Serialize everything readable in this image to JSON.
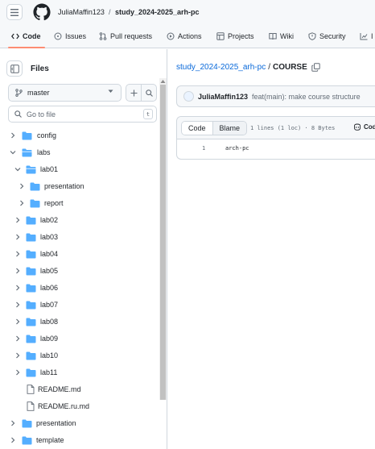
{
  "header": {
    "owner": "JuliaMaffin123",
    "separator": "/",
    "repo": "study_2024-2025_arh-pc"
  },
  "nav": {
    "tabs": [
      {
        "label": "Code",
        "icon": "code-icon"
      },
      {
        "label": "Issues",
        "icon": "issue-icon"
      },
      {
        "label": "Pull requests",
        "icon": "pull-request-icon"
      },
      {
        "label": "Actions",
        "icon": "play-icon"
      },
      {
        "label": "Projects",
        "icon": "table-icon"
      },
      {
        "label": "Wiki",
        "icon": "book-icon"
      },
      {
        "label": "Security",
        "icon": "shield-icon"
      },
      {
        "label": "I",
        "icon": "graph-icon"
      }
    ]
  },
  "sidebar": {
    "title": "Files",
    "branch": "master",
    "search_placeholder": "Go to file",
    "shortcut": "t",
    "tree": [
      {
        "label": "config",
        "type": "folder",
        "expanded": false
      },
      {
        "label": "labs",
        "type": "folder",
        "expanded": true
      },
      {
        "label": "lab01",
        "type": "folder",
        "expanded": true
      },
      {
        "label": "presentation",
        "type": "folder",
        "expanded": false
      },
      {
        "label": "report",
        "type": "folder",
        "expanded": false
      },
      {
        "label": "lab02",
        "type": "folder",
        "expanded": false
      },
      {
        "label": "lab03",
        "type": "folder",
        "expanded": false
      },
      {
        "label": "lab04",
        "type": "folder",
        "expanded": false
      },
      {
        "label": "lab05",
        "type": "folder",
        "expanded": false
      },
      {
        "label": "lab06",
        "type": "folder",
        "expanded": false
      },
      {
        "label": "lab07",
        "type": "folder",
        "expanded": false
      },
      {
        "label": "lab08",
        "type": "folder",
        "expanded": false
      },
      {
        "label": "lab09",
        "type": "folder",
        "expanded": false
      },
      {
        "label": "lab10",
        "type": "folder",
        "expanded": false
      },
      {
        "label": "lab11",
        "type": "folder",
        "expanded": false
      },
      {
        "label": "README.md",
        "type": "file"
      },
      {
        "label": "README.ru.md",
        "type": "file"
      },
      {
        "label": "presentation",
        "type": "folder",
        "expanded": false
      },
      {
        "label": "template",
        "type": "folder",
        "expanded": false
      }
    ]
  },
  "main": {
    "path_repo": "study_2024-2025_arh-pc",
    "path_sep": "/",
    "path_file": "COURSE",
    "commit": {
      "author": "JuliaMaffin123",
      "message": "feat(main): make course structure"
    },
    "file": {
      "view_code": "Code",
      "view_blame": "Blame",
      "meta": "1 lines (1 loc) · 8 Bytes",
      "copilot": "Cod",
      "lines": [
        {
          "no": "1",
          "text": "arch-pc"
        }
      ]
    }
  },
  "colors": {
    "accent": "#0969da",
    "folder": "#54aeff",
    "tab_underline": "#fd8c73",
    "border": "#d0d7de"
  }
}
